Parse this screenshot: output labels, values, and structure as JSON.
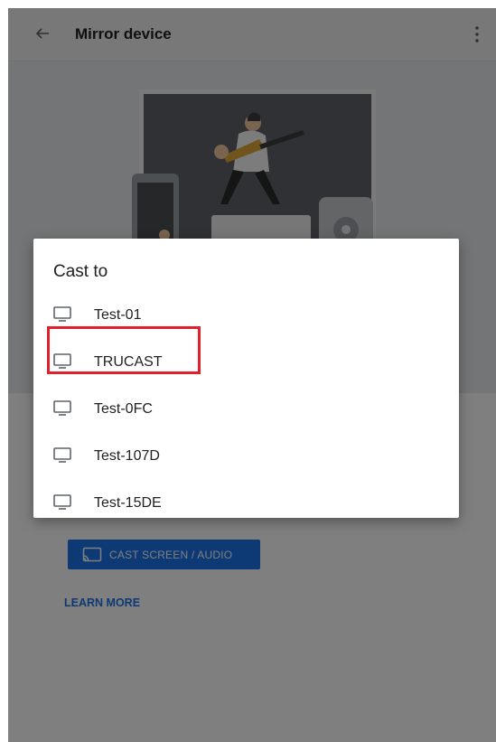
{
  "appbar": {
    "title": "Mirror device"
  },
  "main": {
    "cast_button_label": "CAST SCREEN / AUDIO",
    "learn_more_label": "LEARN MORE"
  },
  "dialog": {
    "title": "Cast to",
    "devices": [
      "Test-01",
      "TRUCAST",
      "Test-0FC",
      "Test-107D",
      "Test-15DE"
    ]
  },
  "colors": {
    "accent": "#1a73e8",
    "highlight": "#e0202a"
  }
}
